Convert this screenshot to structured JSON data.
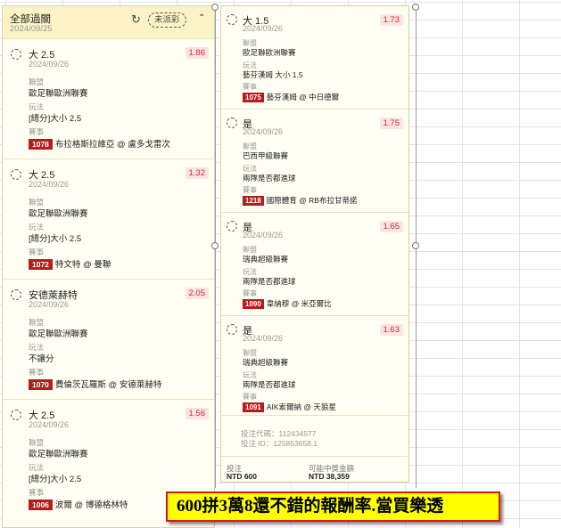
{
  "header": {
    "title": "全部過關",
    "date": "2024/09/25",
    "status_pill": "未派彩"
  },
  "left_bets": [
    {
      "pick": "大 2.5",
      "date": "2024/09/26",
      "odds": "1.86",
      "league_label": "聯盟",
      "league": "歐足聯歐洲聯賽",
      "market_label": "玩法",
      "market": "[總分]大小 2.5",
      "event_label": "賽事",
      "event_id": "1078",
      "event": "布拉格斯拉維亞 @ 盧多戈雷次"
    },
    {
      "pick": "大 2.5",
      "date": "2024/09/26",
      "odds": "1.32",
      "league_label": "聯盟",
      "league": "歐足聯歐洲聯賽",
      "market_label": "玩法",
      "market": "[總分]大小 2.5",
      "event_label": "賽事",
      "event_id": "1072",
      "event": "特文特 @ 曼聯"
    },
    {
      "pick": "安德萊赫特",
      "date": "2024/09/26",
      "odds": "2.05",
      "league_label": "聯盟",
      "league": "歐足聯歐洲聯賽",
      "market_label": "玩法",
      "market": "不讓分",
      "event_label": "賽事",
      "event_id": "1070",
      "event": "費倫茨瓦羅斯 @ 安德萊赫特"
    },
    {
      "pick": "大 2.5",
      "date": "2024/09/26",
      "odds": "1.56",
      "league_label": "聯盟",
      "league": "歐足聯歐洲聯賽",
      "market_label": "玩法",
      "market": "[總分]大小 2.5",
      "event_label": "賽事",
      "event_id": "1006",
      "event": "波爾 @ 博德格林特"
    }
  ],
  "right_bets": [
    {
      "pick": "大 1.5",
      "date": "2024/09/26",
      "odds": "1.73",
      "league_label": "聯盟",
      "league": "歐足聯歐洲聯賽",
      "market_label": "玩法",
      "market": "藝芬漢姆 大小 1.5",
      "event_label": "賽事",
      "event_id": "1075",
      "event": "藝芬漢姆 @ 中日德爾"
    },
    {
      "pick": "是",
      "date": "2024/09/26",
      "odds": "1.75",
      "league_label": "聯盟",
      "league": "巴西甲級聯賽",
      "market_label": "玩法",
      "market": "兩隊是否都進球",
      "event_label": "賽事",
      "event_id": "1218",
      "event": "國際體育 @ RB布拉甘蒂諾"
    },
    {
      "pick": "是",
      "date": "2024/09/26",
      "odds": "1.65",
      "league_label": "聯盟",
      "league": "瑞典超級聯賽",
      "market_label": "玩法",
      "market": "兩隊是否都進球",
      "event_label": "賽事",
      "event_id": "1090",
      "event": "韋納穆 @ 米亞爾比"
    },
    {
      "pick": "是",
      "date": "2024/09/26",
      "odds": "1.63",
      "league_label": "聯盟",
      "league": "瑞典超級聯賽",
      "market_label": "玩法",
      "market": "兩隊是否都進球",
      "event_label": "賽事",
      "event_id": "1091",
      "event": "AIK索爾納 @ 天狼星"
    }
  ],
  "meta": {
    "code": "投注代碼：112434577",
    "bet_id": "投注 ID：125853658.1"
  },
  "footer": {
    "stake_label": "投注",
    "stake_value": "NTD 600",
    "payout_label": "可能中獎金額",
    "payout_value": "NTD 38,359"
  },
  "banner": {
    "text": "600拼3萬8還不錯的報酬率.當買樂透"
  },
  "colors": {
    "odds_text": "#c53030",
    "odds_bg": "#fde3e3",
    "event_badge": "#b71c1c",
    "header_bg": "#fbf3c6",
    "banner_bg": "#ffff00",
    "banner_border": "#d81818"
  },
  "icons": {
    "refresh": "refresh-icon",
    "collapse": "chevron-up-icon",
    "selection": "radio-circle-icon"
  }
}
